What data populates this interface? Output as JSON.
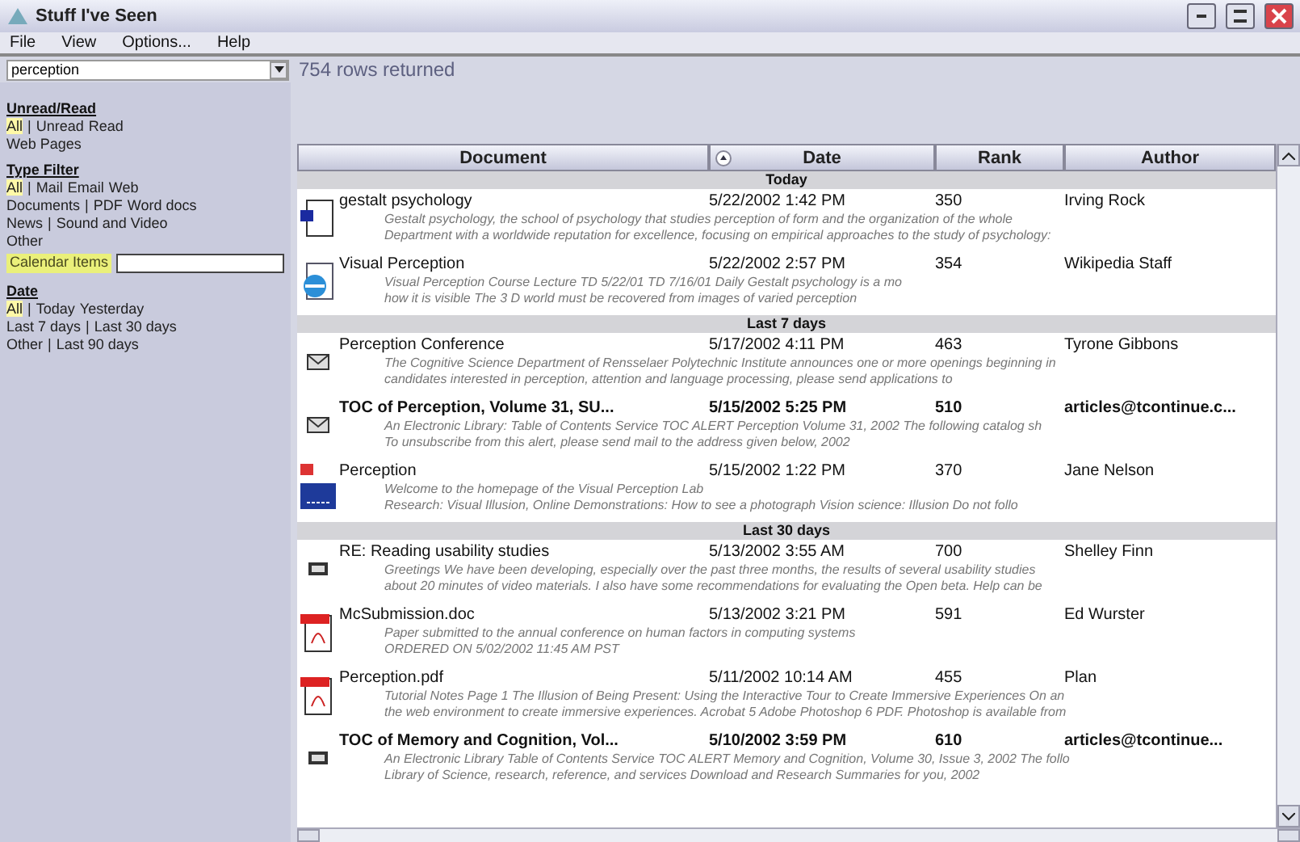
{
  "window": {
    "title": "Stuff I've Seen"
  },
  "menu": [
    "File",
    "View",
    "Options...",
    "Help"
  ],
  "query": {
    "value": "perception",
    "status": "754 rows returned"
  },
  "sidebar": {
    "sections": [
      {
        "heading": "Unread/Read",
        "lines": [
          [
            {
              "kind": "link",
              "text": "All",
              "selected": true
            },
            {
              "kind": "sep",
              "text": "|"
            },
            {
              "kind": "link",
              "text": "Unread",
              "selected": false
            },
            {
              "kind": "link",
              "text": "Read",
              "selected": false
            }
          ],
          [
            {
              "kind": "link",
              "text": "Web Pages",
              "selected": false
            }
          ]
        ]
      },
      {
        "heading": "Type Filter",
        "lines": [
          [
            {
              "kind": "link",
              "text": "All",
              "selected": true
            },
            {
              "kind": "sep",
              "text": "|"
            },
            {
              "kind": "link",
              "text": "Mail",
              "selected": false
            },
            {
              "kind": "link",
              "text": "Email",
              "selected": false
            },
            {
              "kind": "link",
              "text": "Web",
              "selected": false
            }
          ],
          [
            {
              "kind": "link",
              "text": "Documents",
              "selected": false
            },
            {
              "kind": "sep",
              "text": "|"
            },
            {
              "kind": "link",
              "text": "PDF",
              "selected": false
            },
            {
              "kind": "link",
              "text": "Word docs",
              "selected": false
            }
          ],
          [
            {
              "kind": "link",
              "text": "News",
              "selected": false
            },
            {
              "kind": "sep",
              "text": "|"
            },
            {
              "kind": "link",
              "text": "Sound and Video",
              "selected": false
            }
          ],
          [
            {
              "kind": "link",
              "text": "Other",
              "selected": false
            }
          ]
        ],
        "extra": {
          "label": "Calendar Items"
        }
      },
      {
        "heading": "Date",
        "lines": [
          [
            {
              "kind": "link",
              "text": "All",
              "selected": true
            },
            {
              "kind": "sep",
              "text": "|"
            },
            {
              "kind": "link",
              "text": "Today",
              "selected": false
            },
            {
              "kind": "link",
              "text": "Yesterday",
              "selected": false
            }
          ],
          [
            {
              "kind": "link",
              "text": "Last 7 days",
              "selected": false
            },
            {
              "kind": "sep",
              "text": "|"
            },
            {
              "kind": "link",
              "text": "Last 30 days",
              "selected": false
            }
          ],
          [
            {
              "kind": "link",
              "text": "Other",
              "selected": false
            },
            {
              "kind": "sep",
              "text": "|"
            },
            {
              "kind": "link",
              "text": "Last 90 days",
              "selected": false
            }
          ]
        ]
      }
    ]
  },
  "table": {
    "columns": [
      {
        "label": "Document",
        "sorted": false
      },
      {
        "label": "Date",
        "sorted": true
      },
      {
        "label": "Rank",
        "sorted": false
      },
      {
        "label": "Author",
        "sorted": false
      }
    ],
    "groups": [
      {
        "label": "Today",
        "rows": [
          {
            "kind": "doc",
            "title": "gestalt psychology",
            "date": "5/22/2002 1:42 PM",
            "rank": "350",
            "author": "Irving Rock",
            "unread": false,
            "summary": [
              "Gestalt psychology, the school of psychology that studies perception of form and the organization of the whole",
              "Department with a worldwide reputation for excellence, focusing on empirical approaches to the study of psychology:"
            ]
          },
          {
            "kind": "web",
            "title": "Visual Perception",
            "date": "5/22/2002 2:57 PM",
            "rank": "354",
            "author": "Wikipedia Staff",
            "unread": false,
            "summary": [
              "Visual Perception Course Lecture TD 5/22/01 TD 7/16/01 Daily Gestalt psychology is a mo",
              "how it is visible The 3 D world must be recovered from images of varied perception"
            ]
          }
        ]
      },
      {
        "label": "Last 7 days",
        "rows": [
          {
            "kind": "mail",
            "title": "Perception Conference",
            "date": "5/17/2002 4:11 PM",
            "rank": "463",
            "author": "Tyrone Gibbons",
            "unread": false,
            "summary": [
              "The Cognitive Science Department of Rensselaer Polytechnic Institute announces one or more openings beginning in",
              "candidates interested in perception, attention and language processing, please send applications to"
            ]
          },
          {
            "kind": "mail",
            "title": "TOC of Perception, Volume 31, SU...",
            "date": "5/15/2002 5:25 PM",
            "rank": "510",
            "author": "articles@tcontinue.c...",
            "unread": true,
            "summary": [
              "An Electronic Library: Table of Contents Service TOC ALERT Perception Volume 31, 2002 The following catalog sh",
              "To unsubscribe from this alert, please send mail to the address given below, 2002"
            ]
          },
          {
            "kind": "image",
            "title": "Perception",
            "date": "5/15/2002 1:22 PM",
            "rank": "370",
            "author": "Jane Nelson",
            "unread": false,
            "summary": [
              "Welcome to the homepage of the Visual Perception Lab",
              "Research: Visual Illusion, Online Demonstrations: How to see a photograph Vision science: Illusion Do not follo"
            ]
          }
        ]
      },
      {
        "label": "Last 30 days",
        "rows": [
          {
            "kind": "doc-small",
            "title": "RE: Reading usability studies",
            "date": "5/13/2002 3:55 AM",
            "rank": "700",
            "author": "Shelley Finn",
            "unread": false,
            "summary": [
              "Greetings We have been developing, especially over the past three months, the results of several usability studies",
              "about 20 minutes of video materials. I also have some recommendations for evaluating the Open beta. Help can be"
            ]
          },
          {
            "kind": "pdf",
            "title": "McSubmission.doc",
            "date": "5/13/2002 3:21 PM",
            "rank": "591",
            "author": "Ed Wurster",
            "unread": false,
            "summary": [
              "Paper submitted to the annual conference on human factors in computing systems",
              "ORDERED ON 5/02/2002 11:45 AM PST"
            ]
          },
          {
            "kind": "pdf",
            "title": "Perception.pdf",
            "date": "5/11/2002 10:14 AM",
            "rank": "455",
            "author": "Plan",
            "unread": false,
            "summary": [
              "Tutorial Notes Page 1 The Illusion of Being Present: Using the Interactive Tour to Create Immersive Experiences On an",
              "the web environment to create immersive experiences. Acrobat 5 Adobe Photoshop 6 PDF. Photoshop is available from"
            ]
          },
          {
            "kind": "doc-small",
            "title": "TOC of Memory and Cognition, Vol...",
            "date": "5/10/2002 3:59 PM",
            "rank": "610",
            "author": "articles@tcontinue...",
            "unread": true,
            "summary": [
              "An Electronic Library Table of Contents Service TOC ALERT Memory and Cognition, Volume 30, Issue 3, 2002 The follo",
              "Library of Science, research, reference, and services Download and Research Summaries for you, 2002"
            ]
          }
        ]
      }
    ]
  }
}
